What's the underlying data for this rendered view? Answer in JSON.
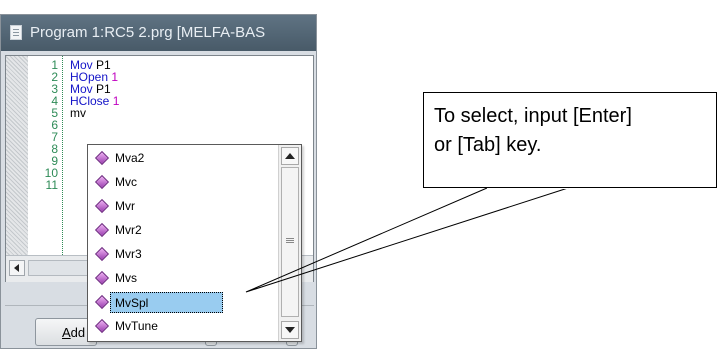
{
  "window": {
    "title": "Program 1:RC5 2.prg  [MELFA-BAS"
  },
  "editor": {
    "line_numbers": [
      "1",
      "2",
      "3",
      "4",
      "5",
      "6",
      "7",
      "8",
      "9",
      "10",
      "11"
    ],
    "lines": [
      {
        "kw": "Mov",
        "rest": " P1",
        "num": ""
      },
      {
        "kw": "HOpen",
        "rest": " ",
        "num": "1"
      },
      {
        "kw": "Mov",
        "rest": " P1",
        "num": ""
      },
      {
        "kw": "HClose",
        "rest": " ",
        "num": "1"
      },
      {
        "kw": "",
        "rest": "mv",
        "num": ""
      }
    ]
  },
  "autocomplete": {
    "items": [
      "Mva2",
      "Mvc",
      "Mvr",
      "Mvr2",
      "Mvr3",
      "Mvs",
      "MvSpl",
      "MvTune"
    ],
    "selected_index": 6,
    "item_icon": "method-diamond-icon"
  },
  "lower_panel": {
    "add_button_label": "Add",
    "add_button_mnemonic": "A"
  },
  "callout": {
    "line1": "To select, input [Enter]",
    "line2": "or [Tab] key."
  },
  "colors": {
    "titlebar": "#5a6c7a",
    "keyword": "#1414c8",
    "number": "#c000c0",
    "line_number": "#2e8b57",
    "selection": "#99ccf0"
  }
}
